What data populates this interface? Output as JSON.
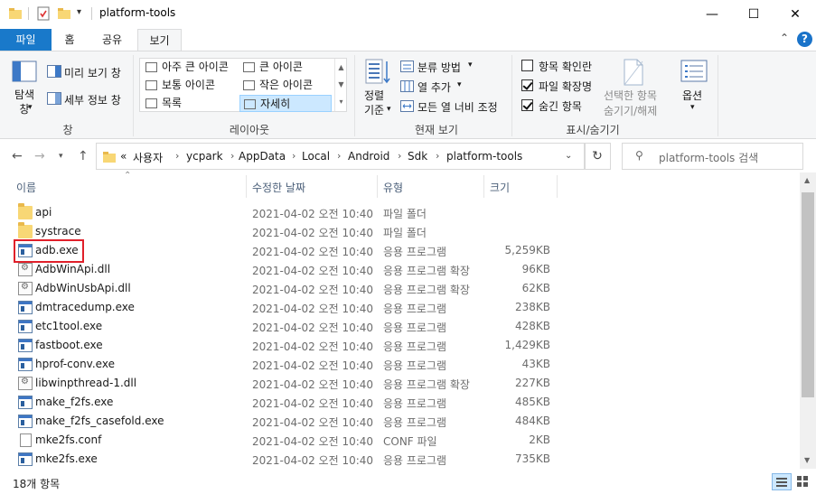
{
  "window": {
    "title": "platform-tools",
    "controls": {
      "minimize": "—",
      "maximize": "☐",
      "close": "✕"
    }
  },
  "ribbon_tabs": {
    "file": "파일",
    "home": "홈",
    "share": "공유",
    "view": "보기",
    "active": "보기"
  },
  "ribbon": {
    "pane": {
      "nav_pane_label": "탐색\n창",
      "preview_pane": "미리 보기 창",
      "details_pane": "세부 정보 창",
      "group_label": "창"
    },
    "layout": {
      "items": [
        "아주 큰 아이콘",
        "큰 아이콘",
        "보통 아이콘",
        "작은 아이콘",
        "목록",
        "자세히"
      ],
      "selected": "자세히",
      "group_label": "레이아웃"
    },
    "current_view": {
      "sort_label": "정렬\n기준",
      "group_by": "분류 방법",
      "add_columns": "열 추가",
      "fit_columns": "모든 열 너비 조정",
      "group_label": "현재 보기"
    },
    "show_hide": {
      "item_checkboxes": {
        "label": "항목 확인란",
        "checked": false
      },
      "file_extensions": {
        "label": "파일 확장명",
        "checked": true
      },
      "hidden_items": {
        "label": "숨긴 항목",
        "checked": true
      },
      "hide_selected_line1": "선택한 항목",
      "hide_selected_line2": "숨기기/해제",
      "options": "옵션",
      "group_label": "표시/숨기기"
    }
  },
  "address": {
    "overflow": "«",
    "breadcrumbs": [
      "사용자",
      "ycpark",
      "AppData",
      "Local",
      "Android",
      "Sdk",
      "platform-tools"
    ],
    "search_placeholder": "platform-tools 검색"
  },
  "columns": {
    "name": "이름",
    "date": "수정한 날짜",
    "type": "유형",
    "size": "크기"
  },
  "files": [
    {
      "name": "api",
      "date": "2021-04-02 오전 10:40",
      "type": "파일 폴더",
      "size": "",
      "icon": "folder-icon"
    },
    {
      "name": "systrace",
      "date": "2021-04-02 오전 10:40",
      "type": "파일 폴더",
      "size": "",
      "icon": "folder-icon"
    },
    {
      "name": "adb.exe",
      "date": "2021-04-02 오전 10:40",
      "type": "응용 프로그램",
      "size": "5,259KB",
      "icon": "exe-icon"
    },
    {
      "name": "AdbWinApi.dll",
      "date": "2021-04-02 오전 10:40",
      "type": "응용 프로그램 확장",
      "size": "96KB",
      "icon": "dll-icon"
    },
    {
      "name": "AdbWinUsbApi.dll",
      "date": "2021-04-02 오전 10:40",
      "type": "응용 프로그램 확장",
      "size": "62KB",
      "icon": "dll-icon"
    },
    {
      "name": "dmtracedump.exe",
      "date": "2021-04-02 오전 10:40",
      "type": "응용 프로그램",
      "size": "238KB",
      "icon": "exe-icon"
    },
    {
      "name": "etc1tool.exe",
      "date": "2021-04-02 오전 10:40",
      "type": "응용 프로그램",
      "size": "428KB",
      "icon": "exe-icon"
    },
    {
      "name": "fastboot.exe",
      "date": "2021-04-02 오전 10:40",
      "type": "응용 프로그램",
      "size": "1,429KB",
      "icon": "exe-icon"
    },
    {
      "name": "hprof-conv.exe",
      "date": "2021-04-02 오전 10:40",
      "type": "응용 프로그램",
      "size": "43KB",
      "icon": "exe-icon"
    },
    {
      "name": "libwinpthread-1.dll",
      "date": "2021-04-02 오전 10:40",
      "type": "응용 프로그램 확장",
      "size": "227KB",
      "icon": "dll-icon"
    },
    {
      "name": "make_f2fs.exe",
      "date": "2021-04-02 오전 10:40",
      "type": "응용 프로그램",
      "size": "485KB",
      "icon": "exe-icon"
    },
    {
      "name": "make_f2fs_casefold.exe",
      "date": "2021-04-02 오전 10:40",
      "type": "응용 프로그램",
      "size": "484KB",
      "icon": "exe-icon"
    },
    {
      "name": "mke2fs.conf",
      "date": "2021-04-02 오전 10:40",
      "type": "CONF 파일",
      "size": "2KB",
      "icon": "conf-file-icon"
    },
    {
      "name": "mke2fs.exe",
      "date": "2021-04-02 오전 10:40",
      "type": "응용 프로그램",
      "size": "735KB",
      "icon": "exe-icon"
    }
  ],
  "status": {
    "count": "18개 항목"
  },
  "colors": {
    "accent": "#1979ca",
    "highlight_box": "#e0202a",
    "selected_layout": "#cce8ff"
  }
}
